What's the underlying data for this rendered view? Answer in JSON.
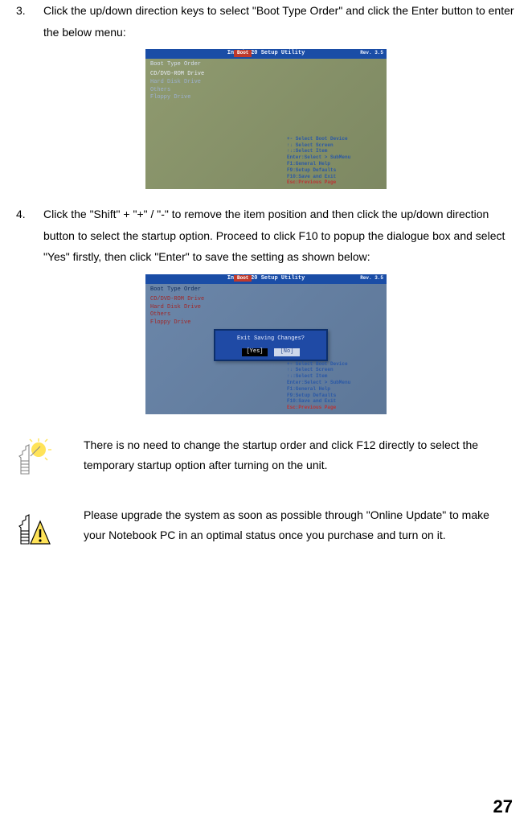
{
  "step3": {
    "num": "3.",
    "text": "Click the up/down direction keys to select \"Boot Type Order\" and click the Enter button to enter the below menu:"
  },
  "step4": {
    "num": "4.",
    "text": "Click the \"Shift\" + \"+\" / \"-\" to remove the item position and then click the up/down direction button to select the startup option. Proceed to click F10 to popup the dialogue box and select \"Yes\" firstly, then click \"Enter\" to save the setting as shown below:"
  },
  "bios": {
    "title": "InsydeH20 Setup Utility",
    "rev": "Rev. 3.5",
    "tab": "Boot",
    "heading": "Boot Type Order",
    "items": [
      "CD/DVD-ROM Drive",
      "Hard Disk Drive",
      "Others",
      "Floppy Drive"
    ],
    "help": [
      "+-    Select Boot Device",
      "↑↓    Select Screen",
      "↑↓:Select Item",
      "Enter:Select > SubMenu",
      "F1:General Help",
      "F9:Setup Defaults",
      "F10:Save and Exit",
      "Esc:Previous Page"
    ],
    "dialog": {
      "msg": "Exit Saving Changes?",
      "yes": "[Yes]",
      "no": "[No]"
    }
  },
  "tip": {
    "text": "There is no need to change the startup order and click F12 directly to select the temporary startup option after turning on the unit."
  },
  "warn": {
    "text": "Please upgrade the system as soon as possible through \"Online  Update\" to make your Notebook PC in an optimal status once you purchase and turn on it."
  },
  "pagenum": "27"
}
